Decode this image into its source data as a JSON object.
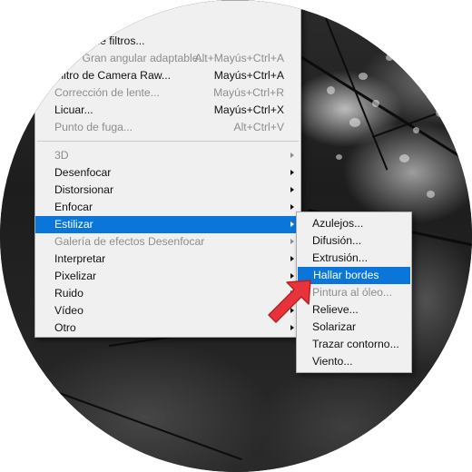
{
  "main_menu": {
    "items": [
      {
        "label": "Galería de filtros...",
        "shortcut": "",
        "disabled": false
      },
      {
        "label": "Filtro Gran angular adaptable...",
        "shortcut": "Alt+Mayús+Ctrl+A",
        "disabled": true
      },
      {
        "label": "Filtro de Camera Raw...",
        "shortcut": "Mayús+Ctrl+A",
        "disabled": false
      },
      {
        "label": "Corrección de lente...",
        "shortcut": "Mayús+Ctrl+R",
        "disabled": true
      },
      {
        "label": "Licuar...",
        "shortcut": "Mayús+Ctrl+X",
        "disabled": false
      },
      {
        "label": "Punto de fuga...",
        "shortcut": "Alt+Ctrl+V",
        "disabled": true
      }
    ],
    "submenus": [
      {
        "label": "3D",
        "disabled": true
      },
      {
        "label": "Desenfocar",
        "disabled": false
      },
      {
        "label": "Distorsionar",
        "disabled": false
      },
      {
        "label": "Enfocar",
        "disabled": false
      },
      {
        "label": "Estilizar",
        "disabled": false,
        "highlighted": true
      },
      {
        "label": "Galería de efectos Desenfocar",
        "disabled": true
      },
      {
        "label": "Interpretar",
        "disabled": false
      },
      {
        "label": "Pixelizar",
        "disabled": false
      },
      {
        "label": "Ruido",
        "disabled": false
      },
      {
        "label": "Vídeo",
        "disabled": false
      },
      {
        "label": "Otro",
        "disabled": false
      }
    ]
  },
  "stylize_submenu": {
    "items": [
      {
        "label": "Azulejos...",
        "disabled": false
      },
      {
        "label": "Difusión...",
        "disabled": false
      },
      {
        "label": "Extrusión...",
        "disabled": false
      },
      {
        "label": "Hallar bordes",
        "disabled": false,
        "highlighted": true
      },
      {
        "label": "Pintura al óleo...",
        "disabled": true
      },
      {
        "label": "Relieve...",
        "disabled": false
      },
      {
        "label": "Solarizar",
        "disabled": false
      },
      {
        "label": "Trazar contorno...",
        "disabled": false
      },
      {
        "label": "Viento...",
        "disabled": false
      }
    ]
  },
  "colors": {
    "highlight": "#0a76d9",
    "menu_bg": "#f0f0f0",
    "disabled_text": "#8d8d8d",
    "pointer_arrow": "#e8333a"
  },
  "icons": {
    "pointer": "red-pointer-arrow-icon",
    "submenu_arrow": "chevron-right-icon"
  }
}
